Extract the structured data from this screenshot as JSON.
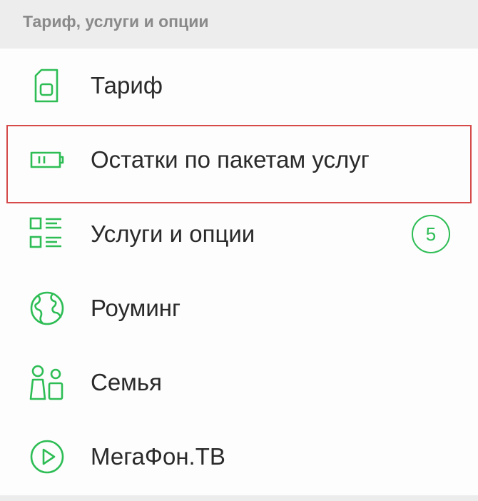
{
  "section": {
    "title": "Тариф, услуги и опции"
  },
  "menu": {
    "items": [
      {
        "label": "Тариф",
        "icon": "sim-card-icon"
      },
      {
        "label": "Остатки по пакетам услуг",
        "icon": "battery-icon",
        "highlighted": true
      },
      {
        "label": "Услуги и опции",
        "icon": "services-list-icon",
        "badge": "5"
      },
      {
        "label": "Роуминг",
        "icon": "globe-icon"
      },
      {
        "label": "Семья",
        "icon": "family-icon"
      },
      {
        "label": "МегаФон.ТВ",
        "icon": "play-icon"
      }
    ]
  },
  "colors": {
    "accent": "#2ebd55",
    "highlight_border": "#d64a4a",
    "header_bg": "#ededed",
    "header_text": "#8a8a8a",
    "item_text": "#2a2a2a"
  }
}
